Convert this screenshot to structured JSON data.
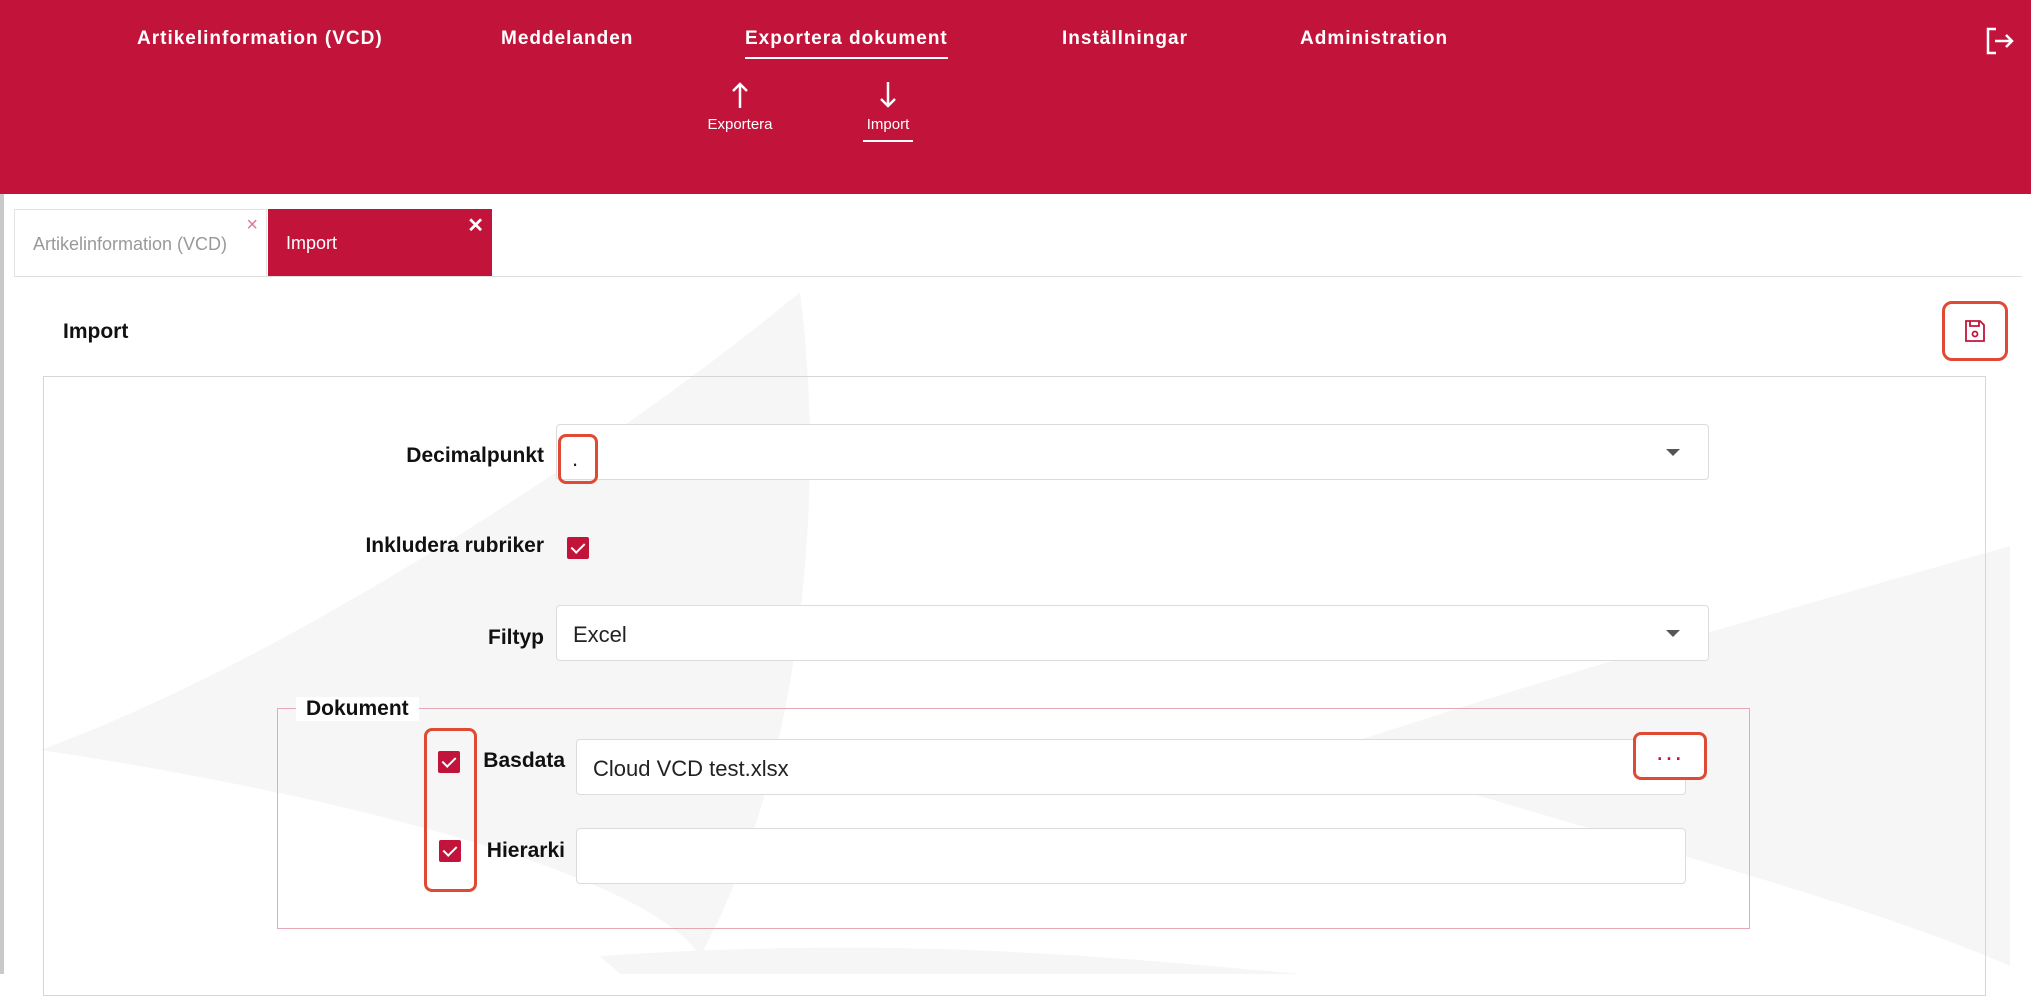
{
  "nav": {
    "items": [
      {
        "label": "Artikelinformation (VCD)"
      },
      {
        "label": "Meddelanden"
      },
      {
        "label": "Exportera dokument"
      },
      {
        "label": "Inställningar"
      },
      {
        "label": "Administration"
      }
    ],
    "active": "Exportera dokument"
  },
  "subnav": {
    "export_label": "Exportera",
    "import_label": "Import"
  },
  "tabs": [
    {
      "label": "Artikelinformation (VCD)",
      "close": "×"
    },
    {
      "label": "Import",
      "close": "✕"
    }
  ],
  "page": {
    "title": "Import"
  },
  "form": {
    "decimal": {
      "label": "Decimalpunkt",
      "value": "."
    },
    "headers": {
      "label": "Inkludera rubriker",
      "checked": true
    },
    "filetype": {
      "label": "Filtyp",
      "value": "Excel"
    },
    "documents": {
      "legend": "Dokument",
      "basdata": {
        "label": "Basdata",
        "value": "Cloud VCD test.xlsx",
        "checked": true,
        "browse_label": "..."
      },
      "hierarki": {
        "label": "Hierarki",
        "value": "",
        "checked": true
      }
    }
  },
  "colors": {
    "brand": "#c2143a",
    "highlight": "#e04a35"
  }
}
